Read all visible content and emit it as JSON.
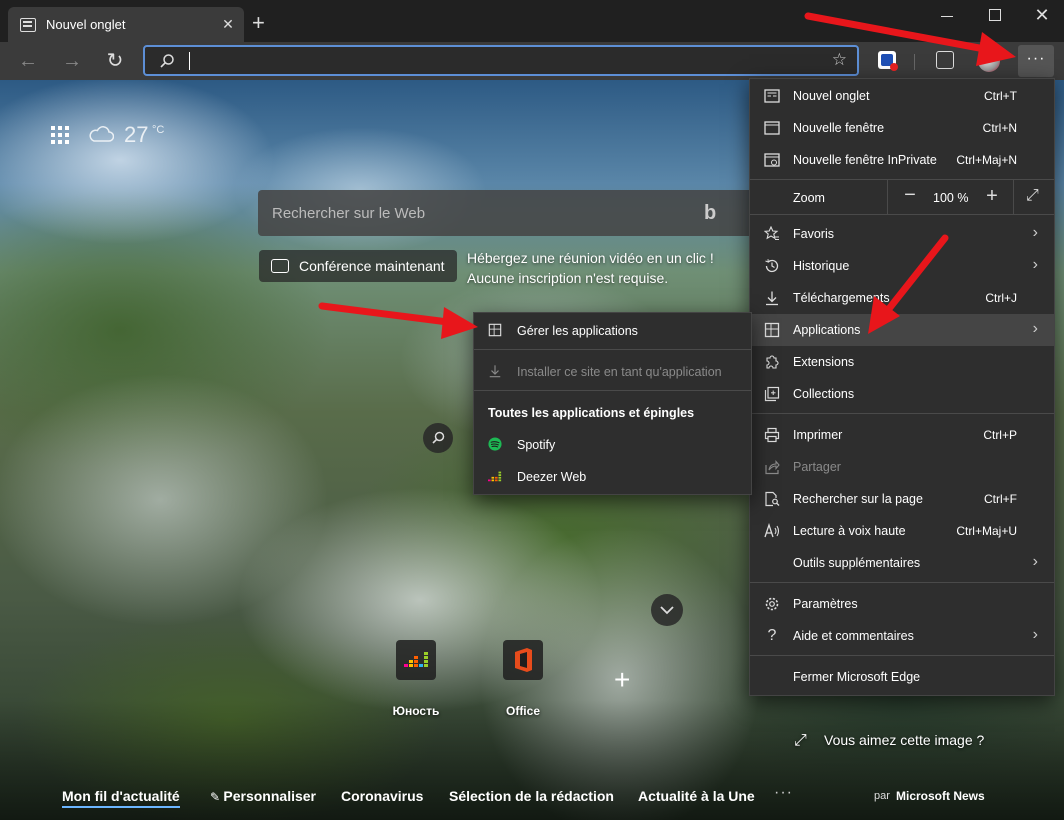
{
  "tab": {
    "title": "Nouvel onglet",
    "close": "✕"
  },
  "window": {
    "close": "✕"
  },
  "toolbar": {
    "back": "←",
    "forward": "→",
    "refresh": "↻",
    "star": "☆",
    "more": "···"
  },
  "address": {
    "value": ""
  },
  "weather": {
    "temperature": "27",
    "unit": "°C"
  },
  "search": {
    "placeholder": "Rechercher sur le Web"
  },
  "conference": {
    "button": "Conférence maintenant",
    "promo": "Hébergez une réunion vidéo en un clic ! Aucune inscription n'est requise."
  },
  "tiles": [
    {
      "label": "Юность"
    },
    {
      "label": "Office"
    }
  ],
  "add_tile": "+",
  "image_info": {
    "label": "Vous aimez cette image ?",
    "expand": "⤢"
  },
  "news": {
    "items": [
      "Mon fil d'actualité",
      "Personnaliser",
      "Coronavirus",
      "Sélection de la rédaction",
      "Actualité à la Une"
    ],
    "more": "···",
    "by": "par",
    "brand": "Microsoft News"
  },
  "menu": {
    "items": [
      {
        "label": "Nouvel onglet",
        "shortcut": "Ctrl+T"
      },
      {
        "label": "Nouvelle fenêtre",
        "shortcut": "Ctrl+N"
      },
      {
        "label": "Nouvelle fenêtre InPrivate",
        "shortcut": "Ctrl+Maj+N"
      },
      {
        "label": "Favoris",
        "shortcut": ""
      },
      {
        "label": "Historique",
        "shortcut": ""
      },
      {
        "label": "Téléchargements",
        "shortcut": "Ctrl+J"
      },
      {
        "label": "Applications",
        "shortcut": ""
      },
      {
        "label": "Extensions",
        "shortcut": ""
      },
      {
        "label": "Collections",
        "shortcut": ""
      },
      {
        "label": "Imprimer",
        "shortcut": "Ctrl+P"
      },
      {
        "label": "Partager",
        "shortcut": ""
      },
      {
        "label": "Rechercher sur la page",
        "shortcut": "Ctrl+F"
      },
      {
        "label": "Lecture à voix haute",
        "shortcut": "Ctrl+Maj+U"
      },
      {
        "label": "Outils supplémentaires",
        "shortcut": ""
      },
      {
        "label": "Paramètres",
        "shortcut": ""
      },
      {
        "label": "Aide et commentaires",
        "shortcut": ""
      },
      {
        "label": "Fermer Microsoft Edge",
        "shortcut": ""
      }
    ],
    "zoom": {
      "label": "Zoom",
      "value": "100 %",
      "minus": "−",
      "plus": "+",
      "fullscreen": "⤢"
    },
    "arrow": "›"
  },
  "submenu": {
    "manage": "Gérer les applications",
    "install": "Installer ce site en tant qu'application",
    "header": "Toutes les applications et épingles",
    "apps": [
      "Spotify",
      "Deezer Web"
    ]
  },
  "colors": {
    "annotation_arrow": "#e8161b",
    "accent": "#5d8fd6",
    "spotify": "#1db954"
  }
}
